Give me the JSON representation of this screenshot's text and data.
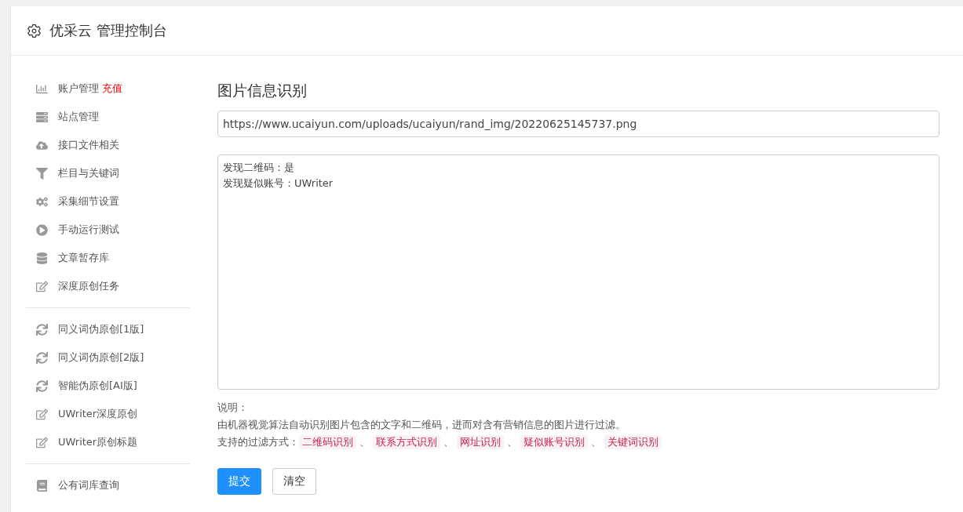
{
  "header": {
    "title": "优采云 管理控制台"
  },
  "sidebar": {
    "groups": [
      {
        "items": [
          {
            "label": "账户管理",
            "badge": "充值"
          },
          {
            "label": "站点管理"
          },
          {
            "label": "接口文件相关"
          },
          {
            "label": "栏目与关键词"
          },
          {
            "label": "采集细节设置"
          },
          {
            "label": "手动运行测试"
          },
          {
            "label": "文章暂存库"
          },
          {
            "label": "深度原创任务"
          }
        ]
      },
      {
        "items": [
          {
            "label": "同义词伪原创[1版]"
          },
          {
            "label": "同义词伪原创[2版]"
          },
          {
            "label": "智能伪原创[AI版]"
          },
          {
            "label": "UWriter深度原创"
          },
          {
            "label": "UWriter原创标题"
          }
        ]
      },
      {
        "items": [
          {
            "label": "公有词库查询"
          }
        ]
      }
    ]
  },
  "main": {
    "title": "图片信息识别",
    "url_field": {
      "value": "https://www.ucaiyun.com/uploads/ucaiyun/rand_img/20220625145737.png"
    },
    "result_box": {
      "lines": [
        "发现二维码：是",
        "发现疑似账号：UWriter"
      ]
    },
    "notes": {
      "heading": "说明：",
      "description": "由机器视觉算法自动识别图片包含的文字和二维码，进而对含有营销信息的图片进行过滤。",
      "methods_label": "支持的过滤方式：",
      "separator": "、",
      "methods": [
        "二维码识别",
        "联系方式识别",
        "网址识别",
        "疑似账号识别",
        "关键词识别"
      ]
    },
    "buttons": [
      {
        "label": "提交",
        "kind": "primary"
      },
      {
        "label": "清空",
        "kind": "default"
      }
    ]
  }
}
